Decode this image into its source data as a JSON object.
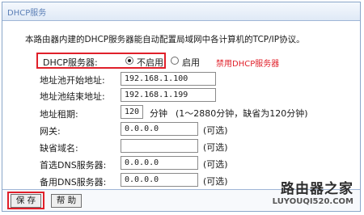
{
  "window": {
    "title": "DHCP服务"
  },
  "description": "本路由器内建的DHCP服务器能自动配置局域网中各计算机的TCP/IP协议。",
  "dhcp_server": {
    "label": "DHCP服务器:",
    "options": [
      "不启用",
      "启用"
    ],
    "selected": "不启用",
    "annotation": "禁用DHCP服务器"
  },
  "fields": {
    "start_ip": {
      "label": "地址池开始地址:",
      "value": "192.168.1.100"
    },
    "end_ip": {
      "label": "地址池结束地址:",
      "value": "192.168.1.199"
    },
    "lease": {
      "label": "地址租期:",
      "value": "120",
      "unit": "分钟",
      "hint": "(1～2880分钟，缺省为120分钟)"
    },
    "gateway": {
      "label": "网关:",
      "value": "0.0.0.0",
      "hint": "(可选)"
    },
    "domain": {
      "label": "缺省域名:",
      "value": "",
      "hint": "(可选)"
    },
    "primary_dns": {
      "label": "首选DNS服务器:",
      "value": "0.0.0.0",
      "hint": "(可选)"
    },
    "secondary_dns": {
      "label": "备用DNS服务器:",
      "value": "0.0.0.0",
      "hint": "(可选)"
    }
  },
  "buttons": {
    "save": "保 存",
    "help": "帮 助"
  },
  "watermark": {
    "name": "路由器之家",
    "url": "LUYOUQI520.COM"
  },
  "colors": {
    "accent_red": "#e0202a",
    "title_blue": "#5b7fb6",
    "border_blue": "#8aa6c9"
  }
}
